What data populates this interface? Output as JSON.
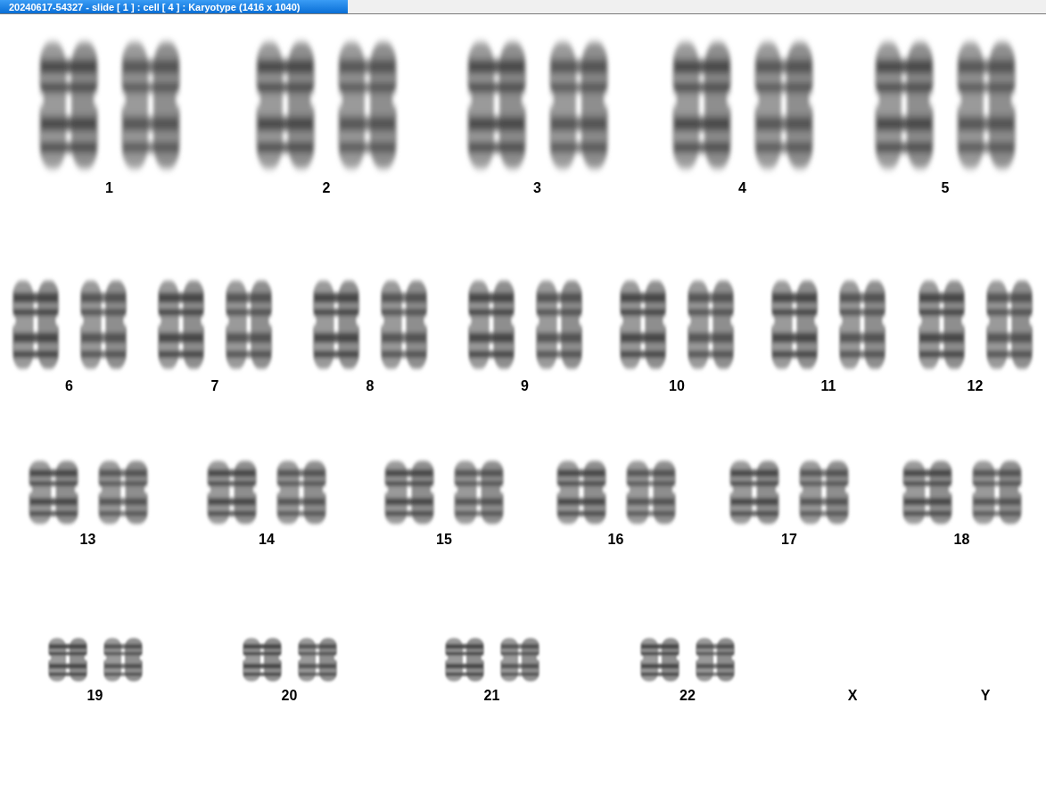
{
  "window": {
    "title": "20240617-54327 - slide [ 1 ] : cell [ 4 ] : Karyotype  (1416 x 1040)"
  },
  "karyotype": {
    "rows": [
      {
        "cells": [
          {
            "label": "1",
            "kind": "pair"
          },
          {
            "label": "2",
            "kind": "pair"
          },
          {
            "label": "3",
            "kind": "pair"
          },
          {
            "label": "4",
            "kind": "pair"
          },
          {
            "label": "5",
            "kind": "pair"
          }
        ]
      },
      {
        "cells": [
          {
            "label": "6",
            "kind": "pair"
          },
          {
            "label": "7",
            "kind": "pair"
          },
          {
            "label": "8",
            "kind": "pair"
          },
          {
            "label": "9",
            "kind": "pair"
          },
          {
            "label": "10",
            "kind": "pair"
          },
          {
            "label": "11",
            "kind": "pair"
          },
          {
            "label": "12",
            "kind": "pair"
          }
        ]
      },
      {
        "cells": [
          {
            "label": "13",
            "kind": "pair"
          },
          {
            "label": "14",
            "kind": "pair"
          },
          {
            "label": "15",
            "kind": "pair"
          },
          {
            "label": "16",
            "kind": "pair"
          },
          {
            "label": "17",
            "kind": "pair"
          },
          {
            "label": "18",
            "kind": "pair"
          }
        ]
      },
      {
        "cells": [
          {
            "label": "19",
            "kind": "pair"
          },
          {
            "label": "20",
            "kind": "pair"
          },
          {
            "label": "21",
            "kind": "pair"
          },
          {
            "label": "22",
            "kind": "pair"
          },
          {
            "label": "X",
            "kind": "empty"
          },
          {
            "label": "Y",
            "kind": "empty"
          }
        ]
      }
    ]
  }
}
